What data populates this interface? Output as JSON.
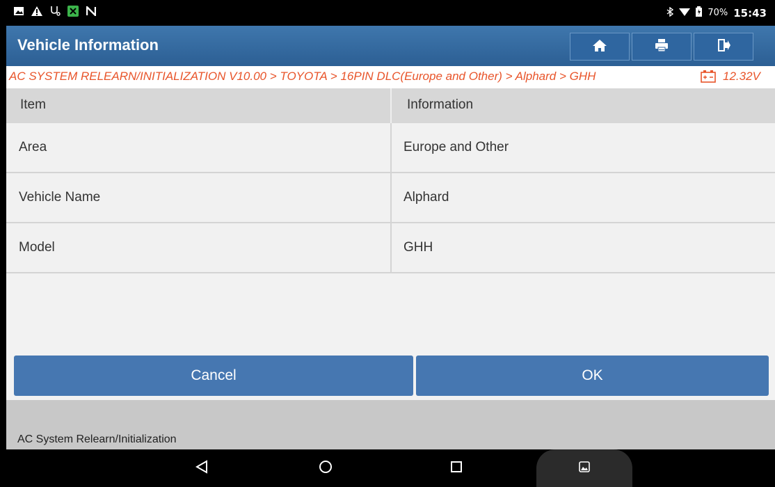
{
  "status_bar": {
    "left_icons": [
      "image-icon",
      "warning-icon",
      "stethoscope-icon",
      "app-icon",
      "n-icon"
    ],
    "battery_percent": "70%",
    "time": "15:43"
  },
  "header": {
    "title": "Vehicle Information",
    "buttons": [
      "home-icon",
      "print-icon",
      "exit-icon"
    ]
  },
  "breadcrumb": {
    "path": "AC SYSTEM RELEARN/INITIALIZATION V10.00 > TOYOTA > 16PIN DLC(Europe and Other) > Alphard > GHH",
    "voltage": "12.32V"
  },
  "table": {
    "headers": {
      "item": "Item",
      "info": "Information"
    },
    "rows": [
      {
        "item": "Area",
        "info": "Europe and Other"
      },
      {
        "item": "Vehicle Name",
        "info": "Alphard"
      },
      {
        "item": "Model",
        "info": "GHH"
      }
    ]
  },
  "actions": {
    "cancel": "Cancel",
    "ok": "OK"
  },
  "footer": {
    "text": "AC System Relearn/Initialization"
  },
  "colors": {
    "title_bar": "#3469a0",
    "breadcrumb_text": "#e8542a",
    "button": "#4677b1"
  }
}
